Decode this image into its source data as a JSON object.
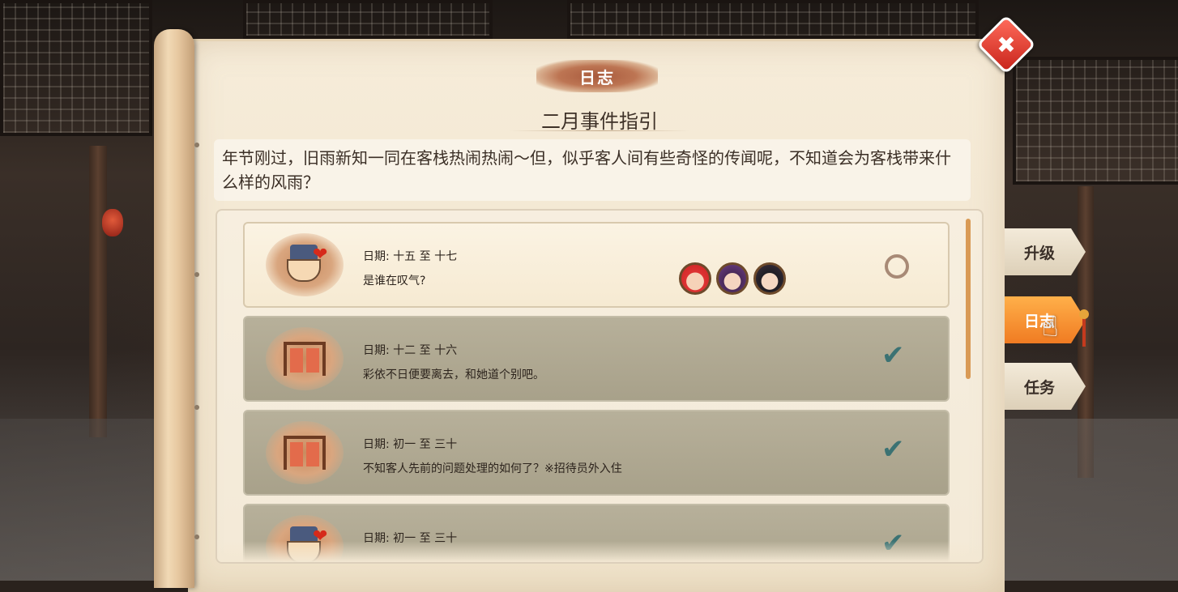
{
  "window": {
    "title": "日志",
    "subtitle": "二月事件指引",
    "description": "年节刚过，旧雨新知一同在客栈热闹热闹～但，似乎客人间有些奇怪的传闻呢，不知道会为客栈带来什么样的风雨？"
  },
  "close_icon": "✖",
  "tabs": [
    {
      "label": "升级",
      "active": false
    },
    {
      "label": "日志",
      "active": true
    },
    {
      "label": "任务",
      "active": false
    }
  ],
  "events": [
    {
      "date": "日期: 十五 至 十七",
      "name": "是谁在叹气?",
      "status": "pending",
      "icon": "innkeeper-heart-icon",
      "avatars": 3
    },
    {
      "date": "日期: 十二 至 十六",
      "name": "彩依不日便要离去，和她道个别吧。",
      "status": "done",
      "icon": "clothes-rack-icon",
      "avatars": 0
    },
    {
      "date": "日期: 初一 至 三十",
      "name": "不知客人先前的问题处理的如何了？※招待员外入住",
      "status": "done",
      "icon": "clothes-rack-icon",
      "avatars": 0
    },
    {
      "date": "日期: 初一 至 三十",
      "name": "",
      "status": "done",
      "icon": "innkeeper-heart-icon",
      "avatars": 0
    }
  ],
  "check_glyph": "✔",
  "heart_glyph": "❤",
  "pointer_glyph": "☝",
  "colors": {
    "accent_orange": "#f07b22",
    "check_teal": "#3b7273",
    "close_red": "#c8241b"
  }
}
